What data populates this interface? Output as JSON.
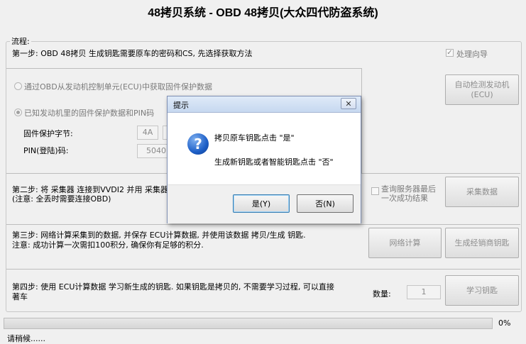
{
  "window": {
    "title": "48拷贝系统 - OBD 48拷贝(大众四代防盗系统)"
  },
  "flow": {
    "legend": "流程:",
    "wizard": {
      "label": "处理向导",
      "checked": true
    },
    "step1": {
      "text": "第一步: OBD 48拷贝 生成钥匙需要原车的密码和CS, 先选择获取方法",
      "option_ecu": "通过OBD从发动机控制单元(ECU)中获取固件保护数据",
      "option_known": "已知发动机里的固件保护数据和PIN码",
      "fw_label": "固件保护字节:",
      "fw_value": "4A",
      "pin_label": "PIN(登陆)码:",
      "pin_value": "5040",
      "auto_detect_btn": "自动检测发动机\n(ECU)"
    },
    "step2": {
      "text_line1": "第二步: 将 采集器 连接到VVDI2 并用 采集器",
      "text_line2": "(注意: 全丢时需要连接OBD)",
      "query_label_line1": "查询服务器最后",
      "query_label_line2": "一次成功结果",
      "collect_btn": "采集数据"
    },
    "step3": {
      "text_line1": "第三步: 网络计算采集到的数据, 并保存 ECU计算数据, 并使用该数据 拷贝/生成 钥匙.",
      "text_line2": "注意: 成功计算一次需扣100积分, 确保你有足够的积分.",
      "net_calc_btn": "网络计算",
      "dealer_key_btn": "生成经销商钥匙"
    },
    "step4": {
      "text_line1": "第四步: 使用 ECU计算数据 学习新生成的钥匙. 如果钥匙是拷贝的, 不需要学习过程, 可以直接",
      "text_line2": "著车",
      "qty_label": "数量:",
      "qty_value": "1",
      "learn_btn": "学习钥匙"
    }
  },
  "progress": {
    "value": 0,
    "label": "0%"
  },
  "status": {
    "text": "请稍候......"
  },
  "dialog": {
    "title": "提示",
    "close": "✕",
    "icon": "?",
    "line1": "拷贝原车钥匙点击 \"是\"",
    "line2": "生成新钥匙或者智能钥匙点击 \"否\"",
    "yes_btn": "是(Y)",
    "no_btn": "否(N)"
  }
}
